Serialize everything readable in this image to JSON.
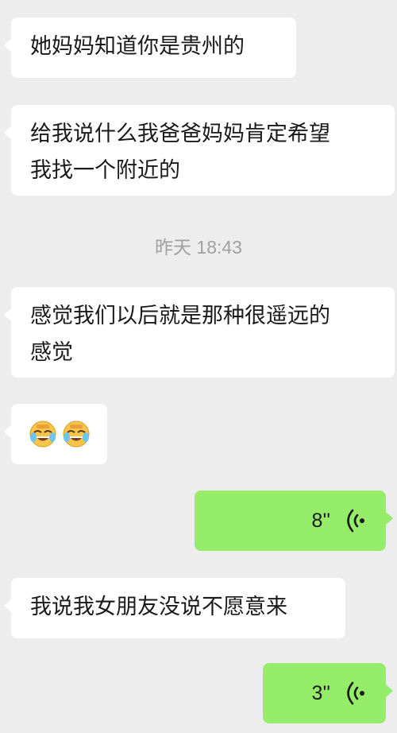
{
  "messages": [
    {
      "type": "text",
      "side": "in",
      "text": "她妈妈知道你是贵州的"
    },
    {
      "type": "text",
      "side": "in",
      "lines": [
        "给我说什么我爸爸妈妈肯定希望",
        "我找一个附近的"
      ]
    },
    {
      "type": "timestamp",
      "text": "昨天 18:43"
    },
    {
      "type": "text",
      "side": "in",
      "lines": [
        "感觉我们以后就是那种很遥远的",
        "感觉"
      ]
    },
    {
      "type": "emoji",
      "side": "in",
      "emojis": [
        "crying-laughing-icon",
        "crying-laughing-icon"
      ]
    },
    {
      "type": "voice",
      "side": "out",
      "duration": "8''",
      "icon": "voice-wave-icon"
    },
    {
      "type": "text",
      "side": "in",
      "text": "我说我女朋友没说不愿意来"
    },
    {
      "type": "voice",
      "side": "out",
      "duration": "3''",
      "icon": "voice-wave-icon"
    }
  ],
  "colors": {
    "background": "#ededed",
    "incoming_bubble": "#ffffff",
    "outgoing_bubble": "#95ec69",
    "timestamp_text": "#a0a0a0"
  }
}
